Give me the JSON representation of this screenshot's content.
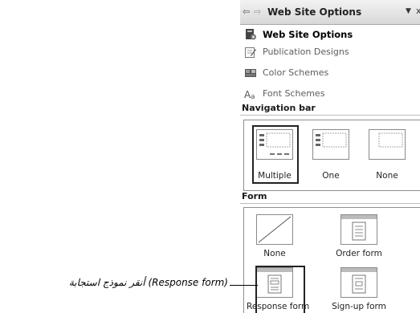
{
  "pane": {
    "back_glyph": "⇦",
    "fwd_glyph": "⇨",
    "title": "Web Site Options",
    "dropdown_glyph": "▼",
    "close_glyph": "x"
  },
  "links": [
    {
      "label": "Web Site Options",
      "icon": "web-site-options-icon",
      "bold": true
    },
    {
      "label": "Publication Designs",
      "icon": "publication-designs-icon",
      "bold": false
    },
    {
      "label": "Color Schemes",
      "icon": "color-schemes-icon",
      "bold": false
    },
    {
      "label": "Font Schemes",
      "icon": "font-schemes-icon",
      "bold": false
    }
  ],
  "navigation_bar": {
    "heading": "Navigation bar",
    "options": [
      "Multiple",
      "One",
      "None"
    ],
    "selected": "Multiple"
  },
  "form": {
    "heading": "Form",
    "options": [
      "None",
      "Order form",
      "Response form",
      "Sign-up form"
    ],
    "selected": "Response form"
  },
  "callout": {
    "arabic_text": "أنقر نموذج استجابة ",
    "latin_text": "(Response form)"
  },
  "colors": {
    "title_gradient_top": "#f2f2f2",
    "title_gradient_bottom": "#d8d8d8",
    "selection_border": "#222222"
  }
}
